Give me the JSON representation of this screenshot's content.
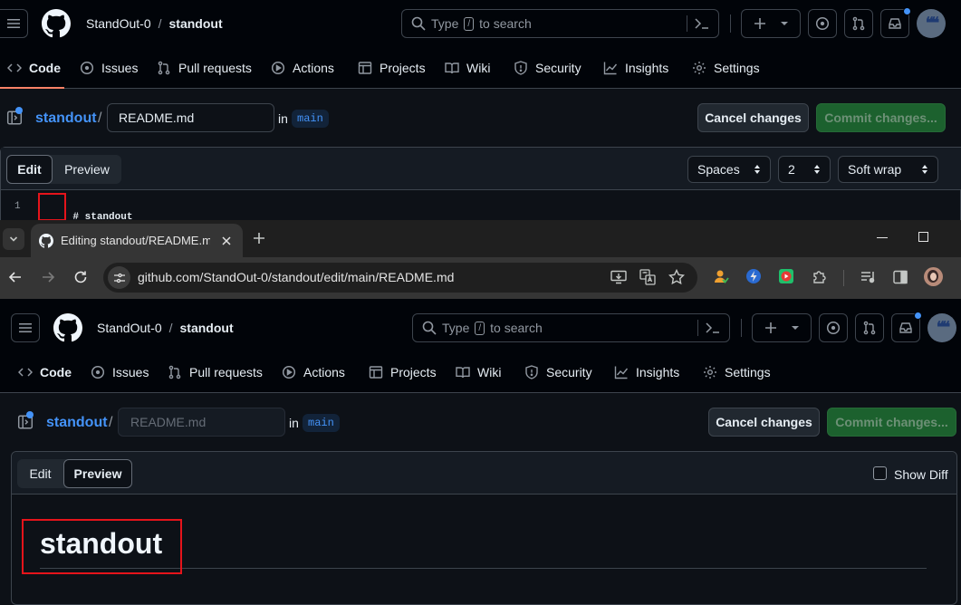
{
  "top": {
    "owner": "StandOut-0",
    "sep": "/",
    "repo": "standout",
    "search_prefix": "Type",
    "search_key": "/",
    "search_suffix": "to search",
    "tabs": [
      "Code",
      "Issues",
      "Pull requests",
      "Actions",
      "Projects",
      "Wiki",
      "Security",
      "Insights",
      "Settings"
    ],
    "repo_label": "standout",
    "filename": "README.md",
    "in_label": "in",
    "branch": "main",
    "cancel": "Cancel changes",
    "commit": "Commit changes...",
    "mode_edit": "Edit",
    "mode_preview": "Preview",
    "indent_mode": "Spaces",
    "indent_size": "2",
    "wrap": "Soft wrap",
    "line_number": "1",
    "line_hash": "#",
    "line_text": "standout"
  },
  "browser": {
    "tab_title": "Editing standout/README.md",
    "url": "github.com/StandOut-0/standout/edit/main/README.md"
  },
  "bottom": {
    "owner": "StandOut-0",
    "sep": "/",
    "repo": "standout",
    "search_prefix": "Type",
    "search_key": "/",
    "search_suffix": "to search",
    "tabs": [
      "Code",
      "Issues",
      "Pull requests",
      "Actions",
      "Projects",
      "Wiki",
      "Security",
      "Insights",
      "Settings"
    ],
    "repo_label": "standout",
    "filename_placeholder": "README.md",
    "in_label": "in",
    "branch": "main",
    "cancel": "Cancel changes",
    "commit": "Commit changes...",
    "mode_edit": "Edit",
    "mode_preview": "Preview",
    "show_diff": "Show Diff",
    "heading": "standout"
  }
}
